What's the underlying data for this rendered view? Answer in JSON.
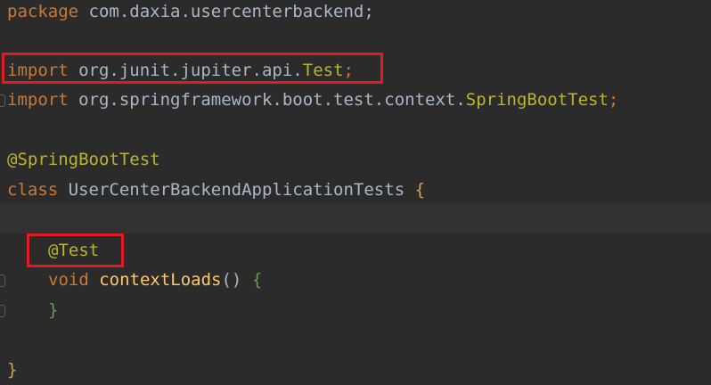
{
  "code": {
    "line1": {
      "kw": "package",
      "rest": " com.daxia.usercenterbackend;"
    },
    "line3": {
      "kw": "import",
      "pkg": " org.junit.jupiter.api.",
      "cls": "Test",
      "semi": ";"
    },
    "line4": {
      "kw": "import",
      "pkg": " org.springframework.boot.test.context.",
      "cls": "SpringBootTest",
      "semi": ";"
    },
    "line6": {
      "ann": "@SpringBootTest"
    },
    "line7": {
      "kw": "class",
      "name": " UserCenterBackendApplicationTests ",
      "brace": "{"
    },
    "line9": {
      "ann": "@Test"
    },
    "line10": {
      "kw": "void",
      "method": " contextLoads",
      "parens": "() ",
      "brace": "{"
    },
    "line11": {
      "brace": "}"
    },
    "line13": {
      "brace": "}"
    }
  },
  "colors": {
    "background": "#2b2b2b",
    "keyword": "#cc7832",
    "annotation": "#bbb529",
    "method": "#ffc66d",
    "highlight_box": "#e01b24"
  }
}
